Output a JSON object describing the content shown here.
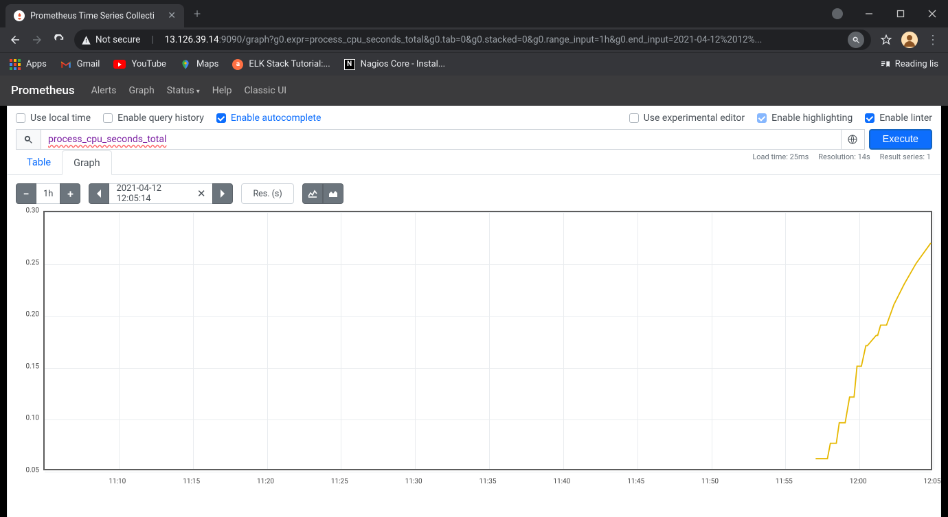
{
  "browser": {
    "tab_title": "Prometheus Time Series Collecti",
    "not_secure": "Not secure",
    "host": "13.126.39.14",
    "url_rest": ":9090/graph?g0.expr=process_cpu_seconds_total&g0.tab=0&g0.stacked=0&g0.range_input=1h&g0.end_input=2021-04-12%2012%...",
    "reading_list": "Reading lis"
  },
  "bookmarks": {
    "apps": "Apps",
    "gmail": "Gmail",
    "youtube": "YouTube",
    "maps": "Maps",
    "elk": "ELK Stack Tutorial:...",
    "nagios": "Nagios Core - Instal..."
  },
  "prom_nav": {
    "brand": "Prometheus",
    "alerts": "Alerts",
    "graph": "Graph",
    "status": "Status",
    "help": "Help",
    "classic": "Classic UI"
  },
  "options": {
    "use_local_time": "Use local time",
    "enable_query_history": "Enable query history",
    "enable_autocomplete": "Enable autocomplete",
    "use_experimental_editor": "Use experimental editor",
    "enable_highlighting": "Enable highlighting",
    "enable_linter": "Enable linter"
  },
  "query": {
    "expression": "process_cpu_seconds_total",
    "execute": "Execute"
  },
  "meta": {
    "load_time": "Load time: 25ms",
    "resolution": "Resolution: 14s",
    "result_series": "Result series: 1"
  },
  "tabs": {
    "table": "Table",
    "graph": "Graph"
  },
  "controls": {
    "range": "1h",
    "end_time": "2021-04-12 12:05:14",
    "res_placeholder": "Res. (s)"
  },
  "chart_data": {
    "type": "line",
    "xlabel": "",
    "ylabel": "",
    "xticks": [
      "11:10",
      "11:15",
      "11:20",
      "11:25",
      "11:30",
      "11:35",
      "11:40",
      "11:45",
      "11:50",
      "11:55",
      "12:00",
      "12:05"
    ],
    "yticks": [
      0.05,
      0.1,
      0.15,
      0.2,
      0.25,
      0.3
    ],
    "ylim": [
      0.05,
      0.3
    ],
    "xrange_minutes": [
      65,
      125
    ],
    "series": [
      {
        "name": "process_cpu_seconds_total",
        "color": "#e6b800",
        "points": [
          [
            117.2,
            0.06
          ],
          [
            118.0,
            0.06
          ],
          [
            118.2,
            0.075
          ],
          [
            118.6,
            0.075
          ],
          [
            118.8,
            0.095
          ],
          [
            119.2,
            0.095
          ],
          [
            119.5,
            0.12
          ],
          [
            119.8,
            0.12
          ],
          [
            120.0,
            0.15
          ],
          [
            120.3,
            0.15
          ],
          [
            120.6,
            0.17
          ],
          [
            120.7,
            0.17
          ],
          [
            121.3,
            0.18
          ],
          [
            121.4,
            0.18
          ],
          [
            121.6,
            0.19
          ],
          [
            122.0,
            0.19
          ],
          [
            122.5,
            0.21
          ],
          [
            123.2,
            0.23
          ],
          [
            124.0,
            0.25
          ],
          [
            125.0,
            0.27
          ]
        ]
      }
    ]
  }
}
